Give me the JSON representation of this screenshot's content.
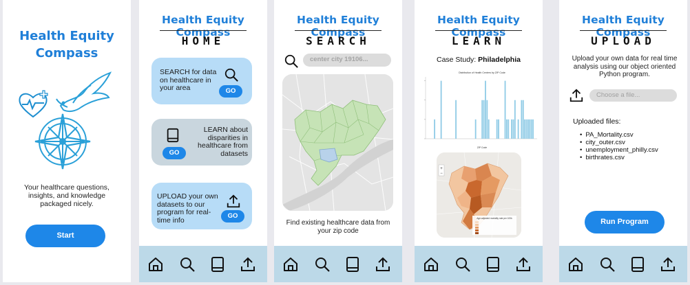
{
  "app": {
    "name": "Health Equity Compass",
    "name_line1": "Health Equity",
    "name_line2": "Compass"
  },
  "splash": {
    "tagline": "Your healthcare questions, insights, and knowledge packaged nicely.",
    "start_label": "Start"
  },
  "home": {
    "section": "HOME",
    "cards": [
      {
        "text": "SEARCH for data on healthcare in your area",
        "go": "GO",
        "icon": "search-icon"
      },
      {
        "text": "LEARN about disparities in healthcare from datasets",
        "go": "GO",
        "icon": "book-icon"
      },
      {
        "text": "UPLOAD your own datasets to our program for real-time info",
        "go": "GO",
        "icon": "upload-icon"
      }
    ]
  },
  "search": {
    "section": "SEARCH",
    "placeholder": "center city 19106...",
    "caption": "Find existing healthcare data from your zip code"
  },
  "learn": {
    "section": "LEARN",
    "case_label": "Case Study:",
    "case_city": "Philadelphia",
    "chart_title": "Distribution of Health Centers by ZIP Code",
    "chart_xlabel": "ZIP Code",
    "map_legend_title": "Age-adjusted mortality rate per 100k"
  },
  "upload": {
    "section": "UPLOAD",
    "description": "Upload your own data for real time analysis using our object oriented Python program.",
    "file_placeholder": "Choose a file...",
    "files_title": "Uploaded files:",
    "files": [
      "PA_Mortality.csv",
      "city_outer.csv",
      "unemployment_philly.csv",
      "birthrates.csv"
    ],
    "run_label": "Run Program"
  },
  "nav": [
    "home-icon",
    "search-icon",
    "book-icon",
    "upload-icon"
  ],
  "colors": {
    "brand": "#1f7fd8",
    "button": "#1e87e8",
    "card_blue": "#b7dcf7",
    "card_gray": "#c9d6de",
    "navbar": "#bcd9e8",
    "bar": "#8fcbe6"
  },
  "chart_data": {
    "type": "bar",
    "title": "Distribution of Health Centers by ZIP Code",
    "xlabel": "ZIP Code",
    "ylabel": "",
    "values": [
      0,
      0,
      0,
      0,
      0,
      1,
      0,
      0,
      0,
      3,
      0,
      0,
      0,
      0,
      0,
      0,
      0,
      0,
      2,
      0,
      0,
      0,
      0,
      0,
      0,
      0,
      0,
      0,
      0,
      0,
      1,
      0,
      0,
      0,
      2,
      2,
      3,
      2,
      1,
      0,
      0,
      0,
      0,
      1,
      1,
      0,
      0,
      0,
      3,
      1,
      1,
      0,
      1,
      1,
      2,
      0,
      1,
      0,
      2,
      2,
      1,
      1,
      1,
      1,
      1,
      1,
      0,
      0
    ],
    "ylim": [
      0,
      3.2
    ],
    "grid": false
  }
}
